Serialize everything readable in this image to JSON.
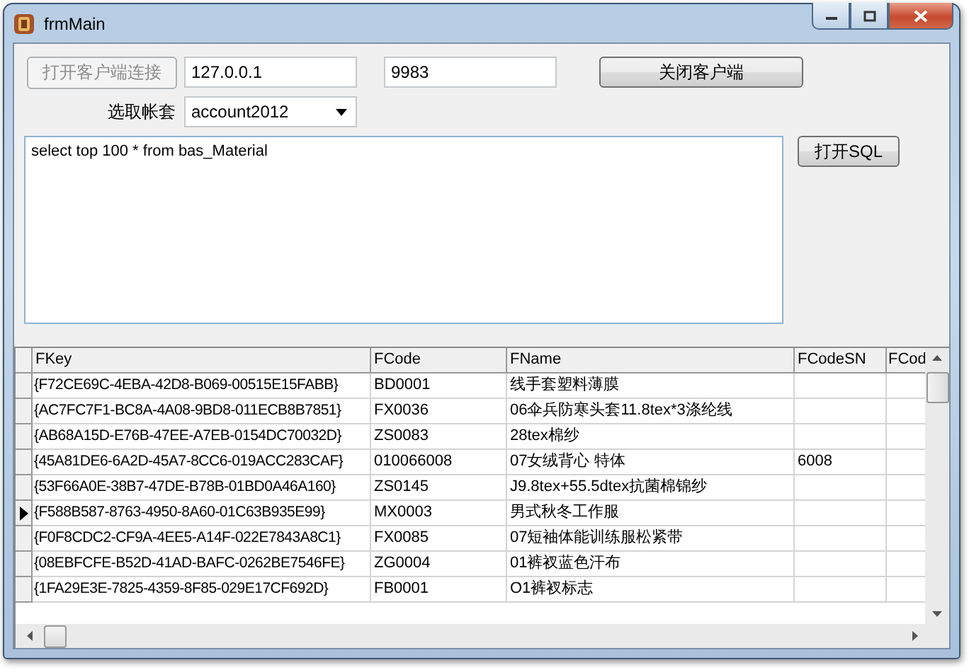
{
  "window": {
    "title": "frmMain"
  },
  "connect_button": {
    "label": "打开客户端连接",
    "disabled": true
  },
  "host_field": {
    "value": "127.0.0.1"
  },
  "port_field": {
    "value": "9983"
  },
  "close_client_button": {
    "label": "关闭客户端",
    "disabled": false
  },
  "account": {
    "label": "选取帐套",
    "value": "account2012"
  },
  "sql_editor": {
    "value": "select top 100 * from bas_Material"
  },
  "open_sql_button": {
    "label": "打开SQL",
    "disabled": false
  },
  "grid": {
    "columns": [
      "FKey",
      "FCode",
      "FName",
      "FCodeSN",
      "FCod"
    ],
    "rows": [
      {
        "cells": [
          "{F72CE69C-4EBA-42D8-B069-00515E15FABB}",
          "BD0001",
          "线手套塑料薄膜",
          ""
        ],
        "current": false
      },
      {
        "cells": [
          "{AC7FC7F1-BC8A-4A08-9BD8-011ECB8B7851}",
          "FX0036",
          "06伞兵防寒头套11.8tex*3涤纶线",
          ""
        ],
        "current": false
      },
      {
        "cells": [
          "{AB68A15D-E76B-47EE-A7EB-0154DC70032D}",
          "ZS0083",
          "28tex棉纱",
          ""
        ],
        "current": false
      },
      {
        "cells": [
          "{45A81DE6-6A2D-45A7-8CC6-019ACC283CAF}",
          "010066008",
          "07女绒背心 特体",
          "6008"
        ],
        "current": false
      },
      {
        "cells": [
          "{53F66A0E-38B7-47DE-B78B-01BD0A46A160}",
          "ZS0145",
          "J9.8tex+55.5dtex抗菌棉锦纱",
          ""
        ],
        "current": false
      },
      {
        "cells": [
          "{F588B587-8763-4950-8A60-01C63B935E99}",
          "MX0003",
          "男式秋冬工作服",
          ""
        ],
        "current": true
      },
      {
        "cells": [
          "{F0F8CDC2-CF9A-4EE5-A14F-022E7843A8C1}",
          "FX0085",
          "07短袖体能训练服松紧带",
          ""
        ],
        "current": false
      },
      {
        "cells": [
          "{08EBFCFE-B52D-41AD-BAFC-0262BE7546FE}",
          "ZG0004",
          "01裤衩蓝色汗布",
          ""
        ],
        "current": false
      },
      {
        "cells": [
          "{1FA29E3E-7825-4359-8F85-029E17CF692D}",
          "FB0001",
          "O1裤衩标志",
          ""
        ],
        "current": false
      }
    ]
  }
}
